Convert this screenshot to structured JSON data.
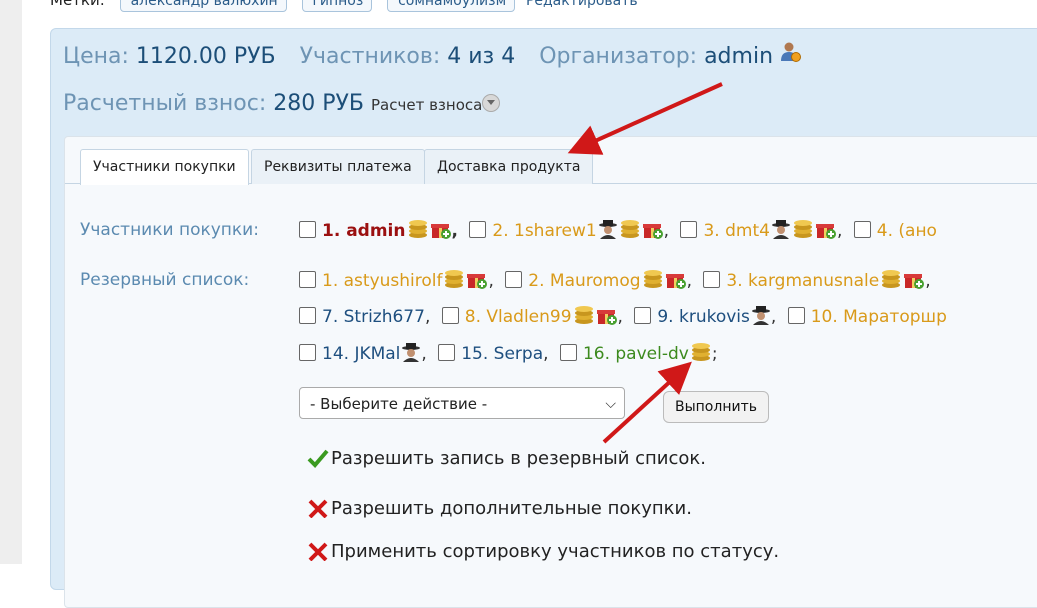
{
  "top_tags": {
    "label": "Метки:",
    "tags": [
      "александр валюхин",
      "гипноз",
      "сомнамбулизм"
    ],
    "edit": "Редактировать"
  },
  "info": {
    "price_label": "Цена:",
    "price_value": "1120.00 РУБ",
    "participants_label": "Участников:",
    "participants_value": "4 из 4",
    "organizer_label": "Организатор:",
    "organizer_value": "admin",
    "fee_label": "Расчетный взнос:",
    "fee_value": "280 РУБ",
    "fee_calc": "Расчет взноса"
  },
  "tabs": [
    "Участники покупки",
    "Реквизиты платежа",
    "Доставка продукта"
  ],
  "participants_label": "Участники покупки:",
  "reserve_label": "Резервный список:",
  "participants": [
    {
      "text": "1. admin",
      "color": "#9b1010"
    },
    {
      "text": "2. 1sharew1",
      "color": "#d99a1a"
    },
    {
      "text": "3. dmt4",
      "color": "#d99a1a"
    },
    {
      "text": "4. (ано",
      "color": "#d99a1a"
    }
  ],
  "reserve_row1": [
    {
      "text": "1. astyushirolf",
      "color": "#d99a1a"
    },
    {
      "text": "2. Mauromog",
      "color": "#d99a1a"
    },
    {
      "text": "3. kargmanusnale",
      "color": "#d99a1a"
    }
  ],
  "reserve_row2": [
    {
      "text": "7. Strizh677",
      "color": "#1e4f7f"
    },
    {
      "text": "8. Vladlen99",
      "color": "#d99a1a"
    },
    {
      "text": "9. krukovis",
      "color": "#1e4f7f"
    },
    {
      "text": "10. Мараторшр",
      "color": "#d99a1a"
    }
  ],
  "reserve_row3": [
    {
      "text": "14. JKMal",
      "color": "#1e4f7f"
    },
    {
      "text": "15. Serpa",
      "color": "#1e4f7f"
    },
    {
      "text": "16. pavel-dv",
      "color": "#3c8a1e"
    }
  ],
  "action_select": {
    "value": "- Выберите действие -"
  },
  "run_button": "Выполнить",
  "options": [
    {
      "text": "Разрешить запись в резервный список.",
      "status": "allowed"
    },
    {
      "text": "Разрешить дополнительные покупки.",
      "status": "denied"
    },
    {
      "text": "Применить сортировку участников по статусу.",
      "status": "denied"
    }
  ],
  "colors": {
    "accent_arrow": "#d01818",
    "panel": "#dcebf7",
    "label": "#6e94b4"
  }
}
